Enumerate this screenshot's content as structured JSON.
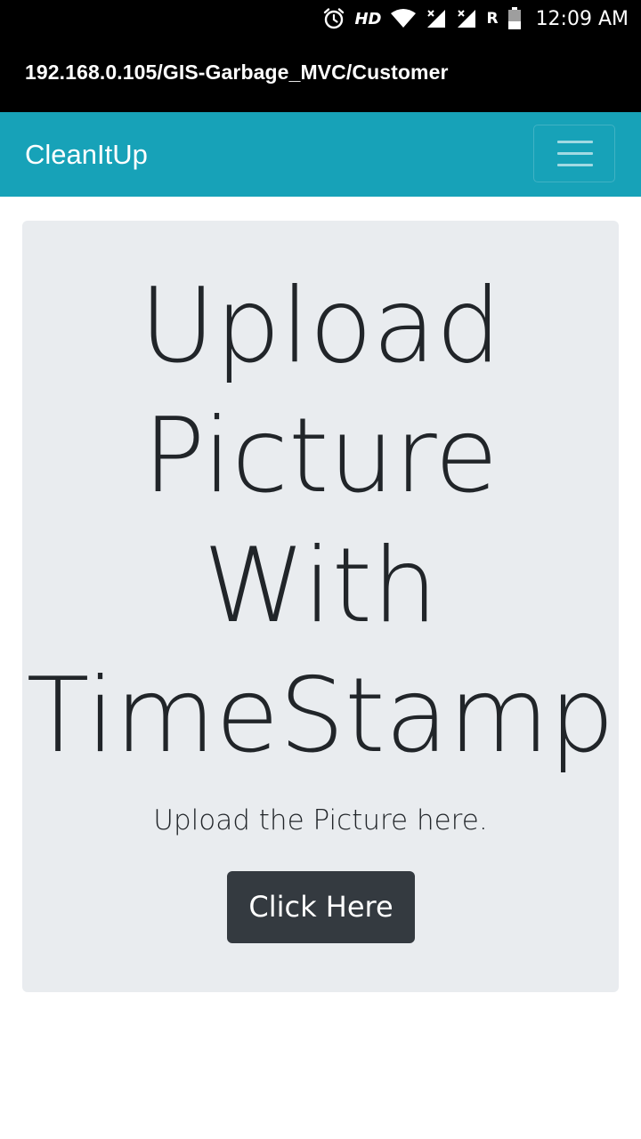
{
  "status_bar": {
    "hd_label": "HD",
    "roaming_label": "R",
    "time": "12:09 AM",
    "icons": [
      "alarm-icon",
      "wifi-icon",
      "signal-icon",
      "signal-icon",
      "battery-icon"
    ]
  },
  "browser": {
    "url": "192.168.0.105/GIS-Garbage_MVC/Customer"
  },
  "navbar": {
    "brand": "CleanItUp",
    "toggler_icon": "hamburger-menu-icon",
    "background_color": "#17a2b8"
  },
  "jumbotron": {
    "heading_line1": "Upload",
    "heading_line2": "Picture",
    "heading_line3": "With",
    "heading_line4": "TimeStamp",
    "lead": "Upload the Picture here.",
    "button_label": "Click Here",
    "background_color": "#e9ecef",
    "button_color": "#343a40"
  }
}
